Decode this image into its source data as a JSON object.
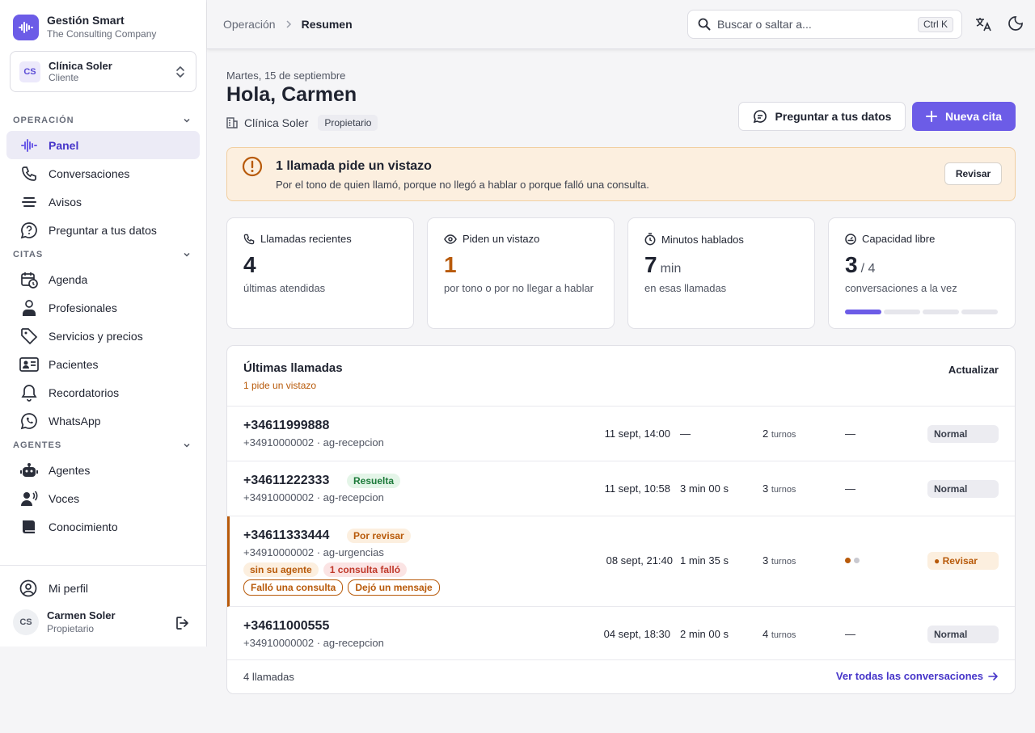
{
  "brand": {
    "name": "Gestión Smart",
    "company": "The Consulting Company"
  },
  "client": {
    "initials": "CS",
    "name": "Clínica Soler",
    "role": "Cliente"
  },
  "sidebar": {
    "groups": [
      {
        "label": "OPERACIÓN",
        "items": [
          {
            "label": "Panel",
            "icon": "waveform-icon"
          },
          {
            "label": "Conversaciones",
            "icon": "phone-icon"
          },
          {
            "label": "Avisos",
            "icon": "list-icon"
          },
          {
            "label": "Preguntar a tus datos",
            "icon": "chat-question-icon"
          }
        ]
      },
      {
        "label": "CITAS",
        "items": [
          {
            "label": "Agenda",
            "icon": "calendar-clock-icon"
          },
          {
            "label": "Profesionales",
            "icon": "doctor-icon"
          },
          {
            "label": "Servicios y precios",
            "icon": "tag-icon"
          },
          {
            "label": "Pacientes",
            "icon": "id-card-icon"
          },
          {
            "label": "Recordatorios",
            "icon": "bell-icon"
          },
          {
            "label": "WhatsApp",
            "icon": "whatsapp-icon"
          }
        ]
      },
      {
        "label": "AGENTES",
        "items": [
          {
            "label": "Agentes",
            "icon": "robot-icon"
          },
          {
            "label": "Voces",
            "icon": "voice-icon"
          },
          {
            "label": "Conocimiento",
            "icon": "book-icon"
          }
        ]
      }
    ],
    "profile_link": "Mi perfil",
    "user": {
      "initials": "CS",
      "name": "Carmen Soler",
      "role": "Propietario"
    }
  },
  "header": {
    "breadcrumb": [
      "Operación",
      "Resumen"
    ],
    "search_placeholder": "Buscar o saltar a...",
    "shortcut": "Ctrl K"
  },
  "main": {
    "date": "Martes, 15 de septiembre",
    "greeting": "Hola, Carmen",
    "org": "Clínica Soler",
    "org_role": "Propietario",
    "ask_button": "Preguntar a tus datos",
    "new_button": "Nueva cita"
  },
  "alert": {
    "title": "1 llamada pide un vistazo",
    "description": "Por el tono de quien llamó, porque no llegó a hablar o porque falló una consulta.",
    "button": "Revisar"
  },
  "stats": [
    {
      "label": "Llamadas recientes",
      "value": "4",
      "unit": "",
      "desc": "últimas atendidas",
      "icon": "phone-icon"
    },
    {
      "label": "Piden un vistazo",
      "value": "1",
      "unit": "",
      "desc": "por tono o por no llegar a hablar",
      "icon": "eye-icon"
    },
    {
      "label": "Minutos hablados",
      "value": "7",
      "unit": "min",
      "desc": "en esas llamadas",
      "icon": "timer-icon"
    },
    {
      "label": "Capacidad libre",
      "value": "3",
      "unit": "/ 4",
      "desc": "conversaciones a la vez",
      "icon": "gauge-icon",
      "capacity_used": 1,
      "capacity_total": 4
    }
  ],
  "calls": {
    "title": "Últimas llamadas",
    "subtitle": "1 pide un vistazo",
    "refresh": "Actualizar",
    "turns_label": "turnos",
    "rows": [
      {
        "number": "+34611999888",
        "sub": "+34910000002 · ag-recepcion",
        "date": "11 sept, 14:00",
        "duration": "—",
        "turns": "2",
        "mood": "—",
        "status": "Normal"
      },
      {
        "number": "+34611222333",
        "tag": "Resuelta",
        "sub": "+34910000002 · ag-recepcion",
        "date": "11 sept, 10:58",
        "duration": "3 min 00 s",
        "turns": "3",
        "mood": "—",
        "status": "Normal"
      },
      {
        "number": "+34611333444",
        "tag": "Por revisar",
        "sub": "+34910000002 · ag-urgencias",
        "chips1": [
          "sin su agente",
          "1 consulta falló"
        ],
        "chips2": [
          "Falló una consulta",
          "Dejó un mensaje"
        ],
        "date": "08 sept, 21:40",
        "duration": "1 min 35 s",
        "turns": "3",
        "mood_dots": [
          1,
          0
        ],
        "status": "Revisar"
      },
      {
        "number": "+34611000555",
        "sub": "+34910000002 · ag-recepcion",
        "date": "04 sept, 18:30",
        "duration": "2 min 00 s",
        "turns": "4",
        "mood": "—",
        "status": "Normal"
      }
    ],
    "footer_count": "4 llamadas",
    "footer_link": "Ver todas las conversaciones"
  },
  "colors": {
    "accent": "#6c5ce7",
    "warning": "#b85a0a",
    "success": "#1d7a3a"
  }
}
